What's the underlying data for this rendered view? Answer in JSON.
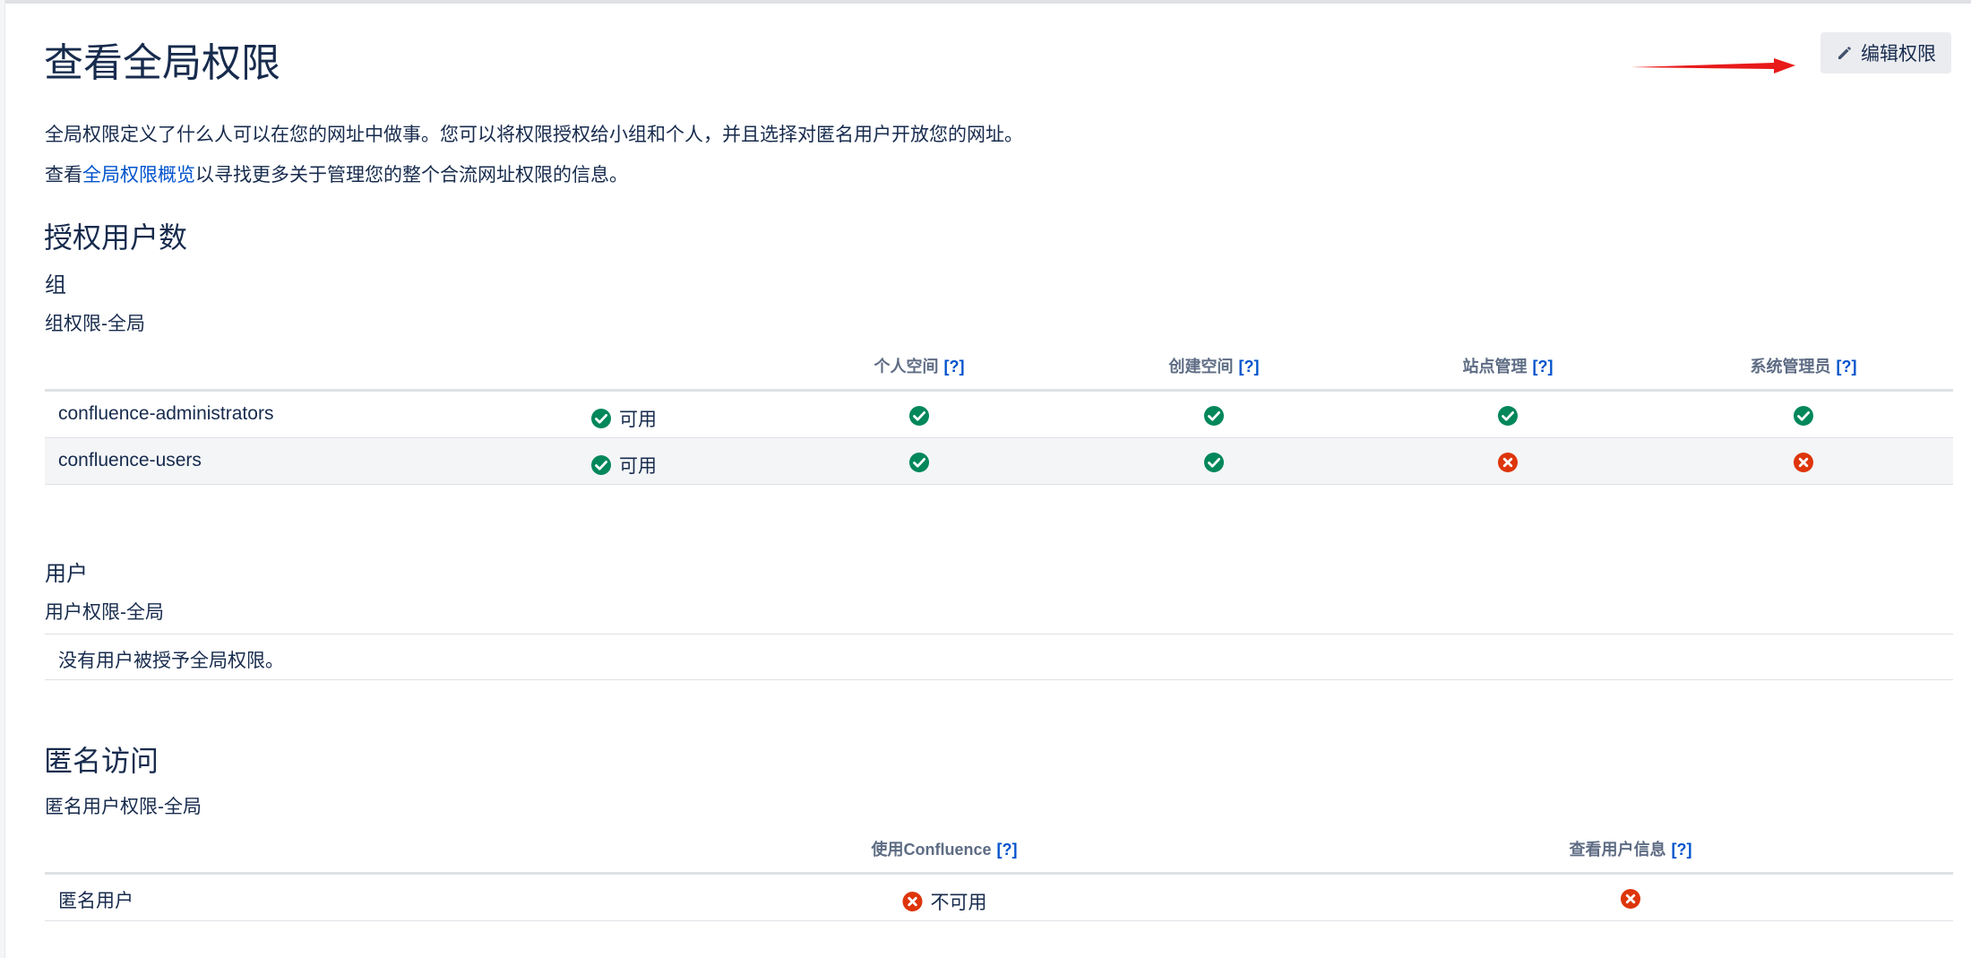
{
  "page": {
    "title": "查看全局权限",
    "edit_label": "编辑权限",
    "intro": "全局权限定义了什么人可以在您的网址中做事。您可以将权限授权给小组和个人，并且选择对匿名用户开放您的网址。",
    "overview_prefix": "查看",
    "overview_link": "全局权限概览",
    "overview_suffix": "以寻找更多关于管理您的整个合流网址权限的信息。"
  },
  "colors": {
    "allowed": "#00875a",
    "denied": "#de350b",
    "link": "#0052cc",
    "arrow": "#e81a1a"
  },
  "licensed": {
    "heading": "授权用户数",
    "groups_heading": "组",
    "groups_caption": "组权限-全局",
    "help_marker": "[?]",
    "columns": [
      "个人空间",
      "创建空间",
      "站点管理",
      "系统管理员"
    ],
    "rows": [
      {
        "name": "confluence-administrators",
        "use_label": "可用",
        "use": "allowed",
        "perms": [
          "allowed",
          "allowed",
          "allowed",
          "allowed"
        ]
      },
      {
        "name": "confluence-users",
        "use_label": "可用",
        "use": "allowed",
        "perms": [
          "allowed",
          "allowed",
          "denied",
          "denied"
        ]
      }
    ],
    "users_heading": "用户",
    "users_caption": "用户权限-全局",
    "users_empty": "没有用户被授予全局权限。"
  },
  "anonymous": {
    "heading": "匿名访问",
    "caption": "匿名用户权限-全局",
    "columns": [
      "使用Confluence",
      "查看用户信息"
    ],
    "row": {
      "name": "匿名用户",
      "use_label": "不可用",
      "use": "denied",
      "view_profiles": "denied"
    }
  }
}
